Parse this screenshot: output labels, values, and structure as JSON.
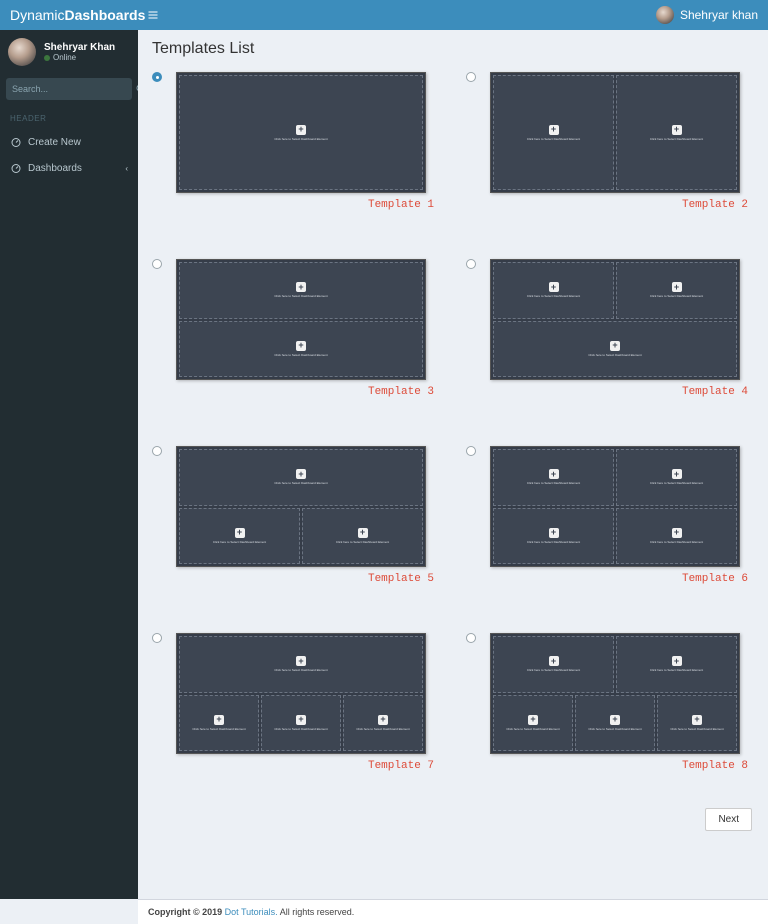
{
  "brand": {
    "left": "Dynamic",
    "bold": "Dashboards"
  },
  "topbar": {
    "user_name": "Shehryar khan"
  },
  "sidebar": {
    "user": {
      "name": "Shehryar Khan",
      "status": "Online"
    },
    "search_placeholder": "Search...",
    "header_label": "HEADER",
    "nav": {
      "create_new": "Create New",
      "dashboards": "Dashboards"
    }
  },
  "content": {
    "title": "Templates List",
    "panel_placeholder": "Click here to Select Dashboard Element",
    "templates": [
      {
        "id": 1,
        "label": "Template 1",
        "layout": [
          [
            1
          ]
        ],
        "selected": true
      },
      {
        "id": 2,
        "label": "Template 2",
        "layout": [
          [
            1,
            1
          ]
        ],
        "selected": false
      },
      {
        "id": 3,
        "label": "Template 3",
        "layout": [
          [
            1
          ],
          [
            1
          ]
        ],
        "selected": false
      },
      {
        "id": 4,
        "label": "Template 4",
        "layout": [
          [
            1,
            1
          ],
          [
            1
          ]
        ],
        "selected": false
      },
      {
        "id": 5,
        "label": "Template 5",
        "layout": [
          [
            1
          ],
          [
            1,
            1
          ]
        ],
        "selected": false
      },
      {
        "id": 6,
        "label": "Template 6",
        "layout": [
          [
            1,
            1
          ],
          [
            1,
            1
          ]
        ],
        "selected": false
      },
      {
        "id": 7,
        "label": "Template 7",
        "layout": [
          [
            1
          ],
          [
            1,
            1,
            1
          ]
        ],
        "selected": false
      },
      {
        "id": 8,
        "label": "Template 8",
        "layout": [
          [
            1,
            1
          ],
          [
            1,
            1,
            1
          ]
        ],
        "selected": false
      }
    ],
    "next_label": "Next"
  },
  "footer": {
    "copyright_prefix": "Copyright © 2019 ",
    "link_text": "Dot Tutorials.",
    "suffix": " All rights reserved."
  }
}
